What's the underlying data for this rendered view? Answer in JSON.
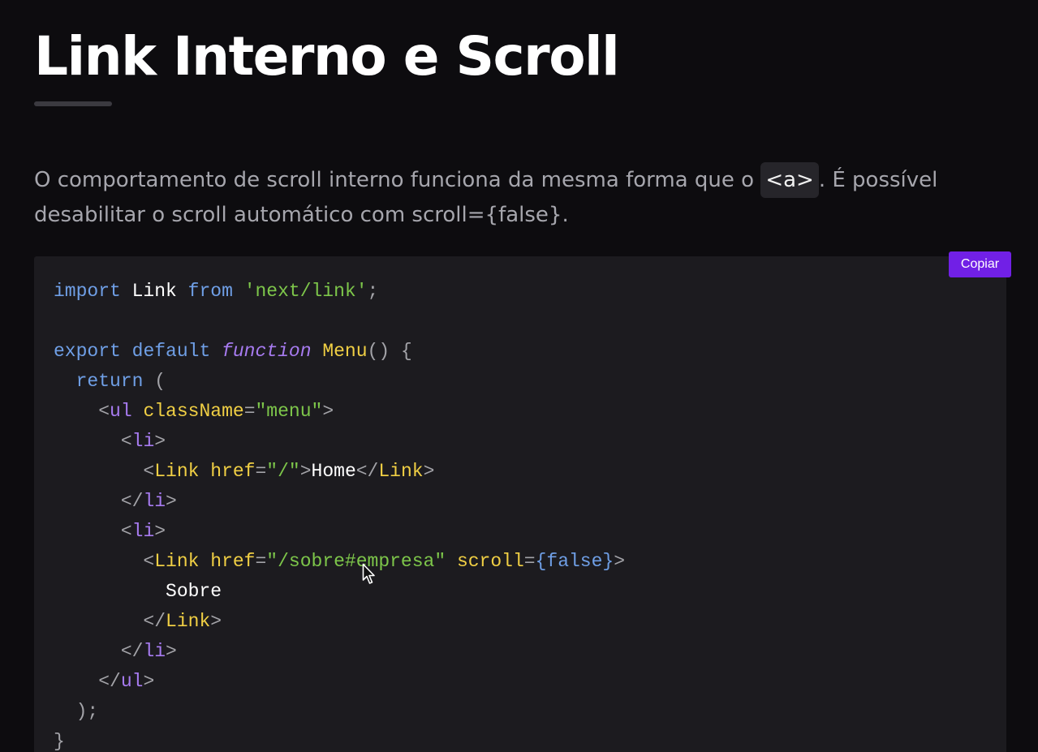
{
  "page": {
    "title": "Link Interno e Scroll",
    "intro": {
      "before": "O comportamento de scroll interno funciona da mesma forma que o ",
      "code": "<a>",
      "after": ". É possível desabilitar o scroll automático com scroll={false}."
    }
  },
  "code_block": {
    "copy_label": "Copiar",
    "lines": [
      [
        [
          "kw",
          "import"
        ],
        [
          "text",
          " Link "
        ],
        [
          "kw",
          "from"
        ],
        [
          "text",
          " "
        ],
        [
          "str",
          "'next/link'"
        ],
        [
          "punc",
          ";"
        ]
      ],
      [],
      [
        [
          "kw",
          "export"
        ],
        [
          "text",
          " "
        ],
        [
          "kw",
          "default"
        ],
        [
          "text",
          " "
        ],
        [
          "fnkw",
          "function"
        ],
        [
          "text",
          " "
        ],
        [
          "name",
          "Menu"
        ],
        [
          "punc",
          "() {"
        ]
      ],
      [
        [
          "text",
          "  "
        ],
        [
          "kw",
          "return"
        ],
        [
          "text",
          " "
        ],
        [
          "punc",
          "("
        ]
      ],
      [
        [
          "text",
          "    "
        ],
        [
          "punc",
          "<"
        ],
        [
          "tag",
          "ul"
        ],
        [
          "text",
          " "
        ],
        [
          "name",
          "className"
        ],
        [
          "punc",
          "="
        ],
        [
          "str",
          "\"menu\""
        ],
        [
          "punc",
          ">"
        ]
      ],
      [
        [
          "text",
          "      "
        ],
        [
          "punc",
          "<"
        ],
        [
          "tag",
          "li"
        ],
        [
          "punc",
          ">"
        ]
      ],
      [
        [
          "text",
          "        "
        ],
        [
          "punc",
          "<"
        ],
        [
          "name",
          "Link"
        ],
        [
          "text",
          " "
        ],
        [
          "name",
          "href"
        ],
        [
          "punc",
          "="
        ],
        [
          "str",
          "\"/\""
        ],
        [
          "punc",
          ">"
        ],
        [
          "text",
          "Home"
        ],
        [
          "punc",
          "</"
        ],
        [
          "name",
          "Link"
        ],
        [
          "punc",
          ">"
        ]
      ],
      [
        [
          "text",
          "      "
        ],
        [
          "punc",
          "</"
        ],
        [
          "tag",
          "li"
        ],
        [
          "punc",
          ">"
        ]
      ],
      [
        [
          "text",
          "      "
        ],
        [
          "punc",
          "<"
        ],
        [
          "tag",
          "li"
        ],
        [
          "punc",
          ">"
        ]
      ],
      [
        [
          "text",
          "        "
        ],
        [
          "punc",
          "<"
        ],
        [
          "name",
          "Link"
        ],
        [
          "text",
          " "
        ],
        [
          "name",
          "href"
        ],
        [
          "punc",
          "="
        ],
        [
          "str",
          "\"/sobre#empresa\""
        ],
        [
          "text",
          " "
        ],
        [
          "name",
          "scroll"
        ],
        [
          "punc",
          "="
        ],
        [
          "kw",
          "{false}"
        ],
        [
          "punc",
          ">"
        ]
      ],
      [
        [
          "text",
          "          Sobre"
        ]
      ],
      [
        [
          "text",
          "        "
        ],
        [
          "punc",
          "</"
        ],
        [
          "name",
          "Link"
        ],
        [
          "punc",
          ">"
        ]
      ],
      [
        [
          "text",
          "      "
        ],
        [
          "punc",
          "</"
        ],
        [
          "tag",
          "li"
        ],
        [
          "punc",
          ">"
        ]
      ],
      [
        [
          "text",
          "    "
        ],
        [
          "punc",
          "</"
        ],
        [
          "tag",
          "ul"
        ],
        [
          "punc",
          ">"
        ]
      ],
      [
        [
          "text",
          "  "
        ],
        [
          "punc",
          ");"
        ]
      ],
      [
        [
          "punc",
          "}"
        ]
      ]
    ]
  },
  "icons": {
    "cursor": "mouse-pointer-icon"
  },
  "colors": {
    "background": "#0d0c0f",
    "code_background": "#1c1b1f",
    "accent": "#7120e6",
    "keyword": "#6f9fe6",
    "function_keyword": "#a77bf0",
    "name": "#f0cf44",
    "string": "#7dc64a",
    "punctuation": "#a3a3a8"
  }
}
